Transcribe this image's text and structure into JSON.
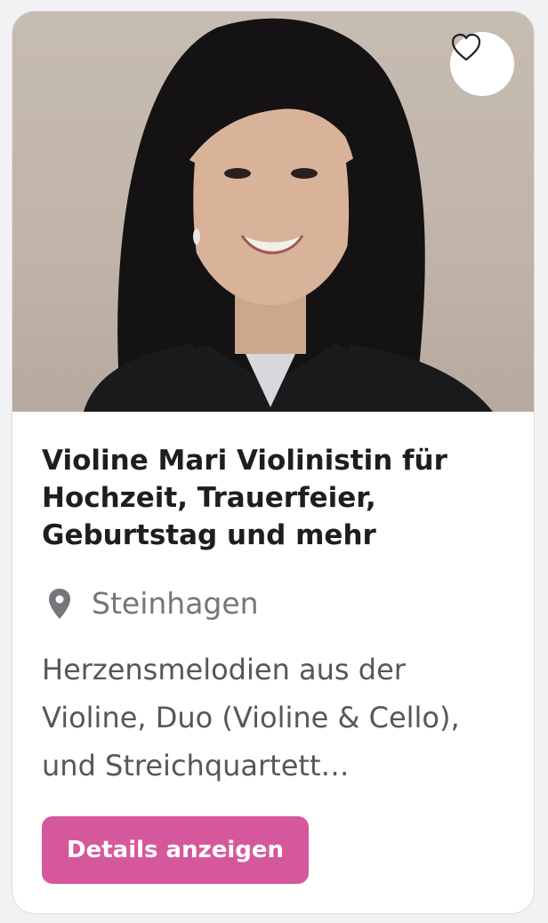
{
  "listing": {
    "title": "Violine Mari Violinistin für Hochzeit, Trauerfeier, Geburtstag und mehr",
    "location": "Steinhagen",
    "description": "Herzensmelodien aus der Violine, Duo (Violine & Cello), und Streichquartett…",
    "details_label": "Details anzeigen",
    "favorite_icon": "heart-outline-icon",
    "location_icon": "map-pin-icon"
  },
  "colors": {
    "accent": "#d6589c",
    "title": "#1e1e22",
    "muted": "#75757a"
  }
}
